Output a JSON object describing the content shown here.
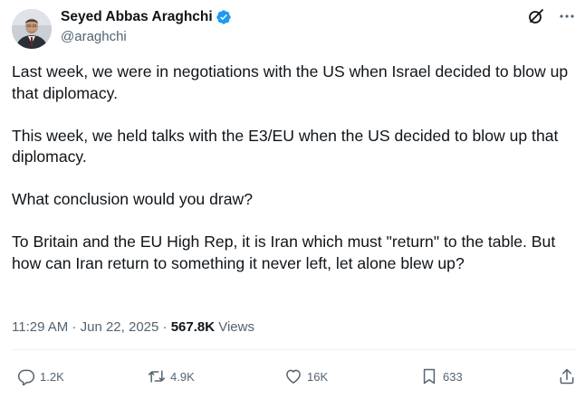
{
  "author": {
    "display_name": "Seyed Abbas Araghchi",
    "handle": "@araghchi",
    "verified": true,
    "verified_color": "#1d9bf0"
  },
  "header_icons": [
    "grok-icon",
    "more-icon"
  ],
  "tweet": {
    "paragraphs": [
      "Last week, we were in negotiations with the US when Israel decided to blow up that diplomacy.",
      "This week, we held talks with the E3/EU when the US decided to blow up that diplomacy.",
      "What conclusion would you draw?",
      "To Britain and the EU High Rep, it is Iran which must \"return\" to the table. But how can Iran return to something it never left, let alone blew up?"
    ]
  },
  "meta": {
    "time": "11:29 AM",
    "separator": " · ",
    "date": "Jun 22, 2025",
    "separator2": " · ",
    "views_count": "567.8K",
    "views_label": " Views"
  },
  "actions": {
    "reply": {
      "icon": "reply-icon",
      "count": "1.2K"
    },
    "repost": {
      "icon": "repost-icon",
      "count": "4.9K"
    },
    "like": {
      "icon": "heart-icon",
      "count": "16K"
    },
    "bookmark": {
      "icon": "bookmark-icon",
      "count": "633"
    },
    "share": {
      "icon": "share-icon"
    }
  },
  "colors": {
    "text_primary": "#0f1419",
    "text_secondary": "#536471",
    "divider": "#eff3f4"
  }
}
